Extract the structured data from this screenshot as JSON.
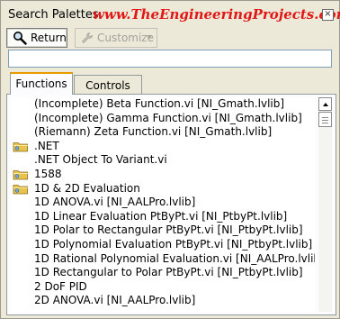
{
  "window": {
    "title": "Search Palettes",
    "watermark": "www.TheEngineeringProjects.com"
  },
  "toolbar": {
    "return_label": "Return",
    "customize_label": "Customize"
  },
  "search": {
    "value": ""
  },
  "tabs": [
    {
      "label": "Functions",
      "active": true
    },
    {
      "label": "Controls",
      "active": false
    }
  ],
  "list": {
    "items": [
      {
        "label": "(Incomplete) Beta Function.vi [NI_Gmath.lvlib]",
        "icon": ""
      },
      {
        "label": "(Incomplete) Gamma Function.vi [NI_Gmath.lvlib]",
        "icon": ""
      },
      {
        "label": "(Riemann) Zeta Function.vi [NI_Gmath.lvlib]",
        "icon": ""
      },
      {
        "label": ".NET",
        "icon": "folder-icon"
      },
      {
        "label": ".NET Object To Variant.vi",
        "icon": ""
      },
      {
        "label": "1588",
        "icon": "folder-icon"
      },
      {
        "label": "1D & 2D Evaluation",
        "icon": "folder-icon"
      },
      {
        "label": "1D ANOVA.vi [NI_AALPro.lvlib]",
        "icon": ""
      },
      {
        "label": "1D Linear Evaluation PtByPt.vi [NI_PtbyPt.lvlib]",
        "icon": ""
      },
      {
        "label": "1D Polar to Rectangular PtByPt.vi [NI_PtbyPt.lvlib]",
        "icon": ""
      },
      {
        "label": "1D Polynomial Evaluation PtByPt.vi [NI_PtbyPt.lvlib]",
        "icon": ""
      },
      {
        "label": "1D Rational Polynomial Evaluation.vi [NI_AALPro.lvlib]",
        "icon": ""
      },
      {
        "label": "1D Rectangular to Polar PtByPt.vi [NI_PtbyPt.lvlib]",
        "icon": ""
      },
      {
        "label": "2 DoF PID",
        "icon": ""
      },
      {
        "label": "2D ANOVA.vi [NI_AALPro.lvlib]",
        "icon": ""
      }
    ]
  },
  "colors": {
    "watermark": "#e01818",
    "tab_highlight": "#e69b00",
    "folder": "#e8c24a"
  }
}
